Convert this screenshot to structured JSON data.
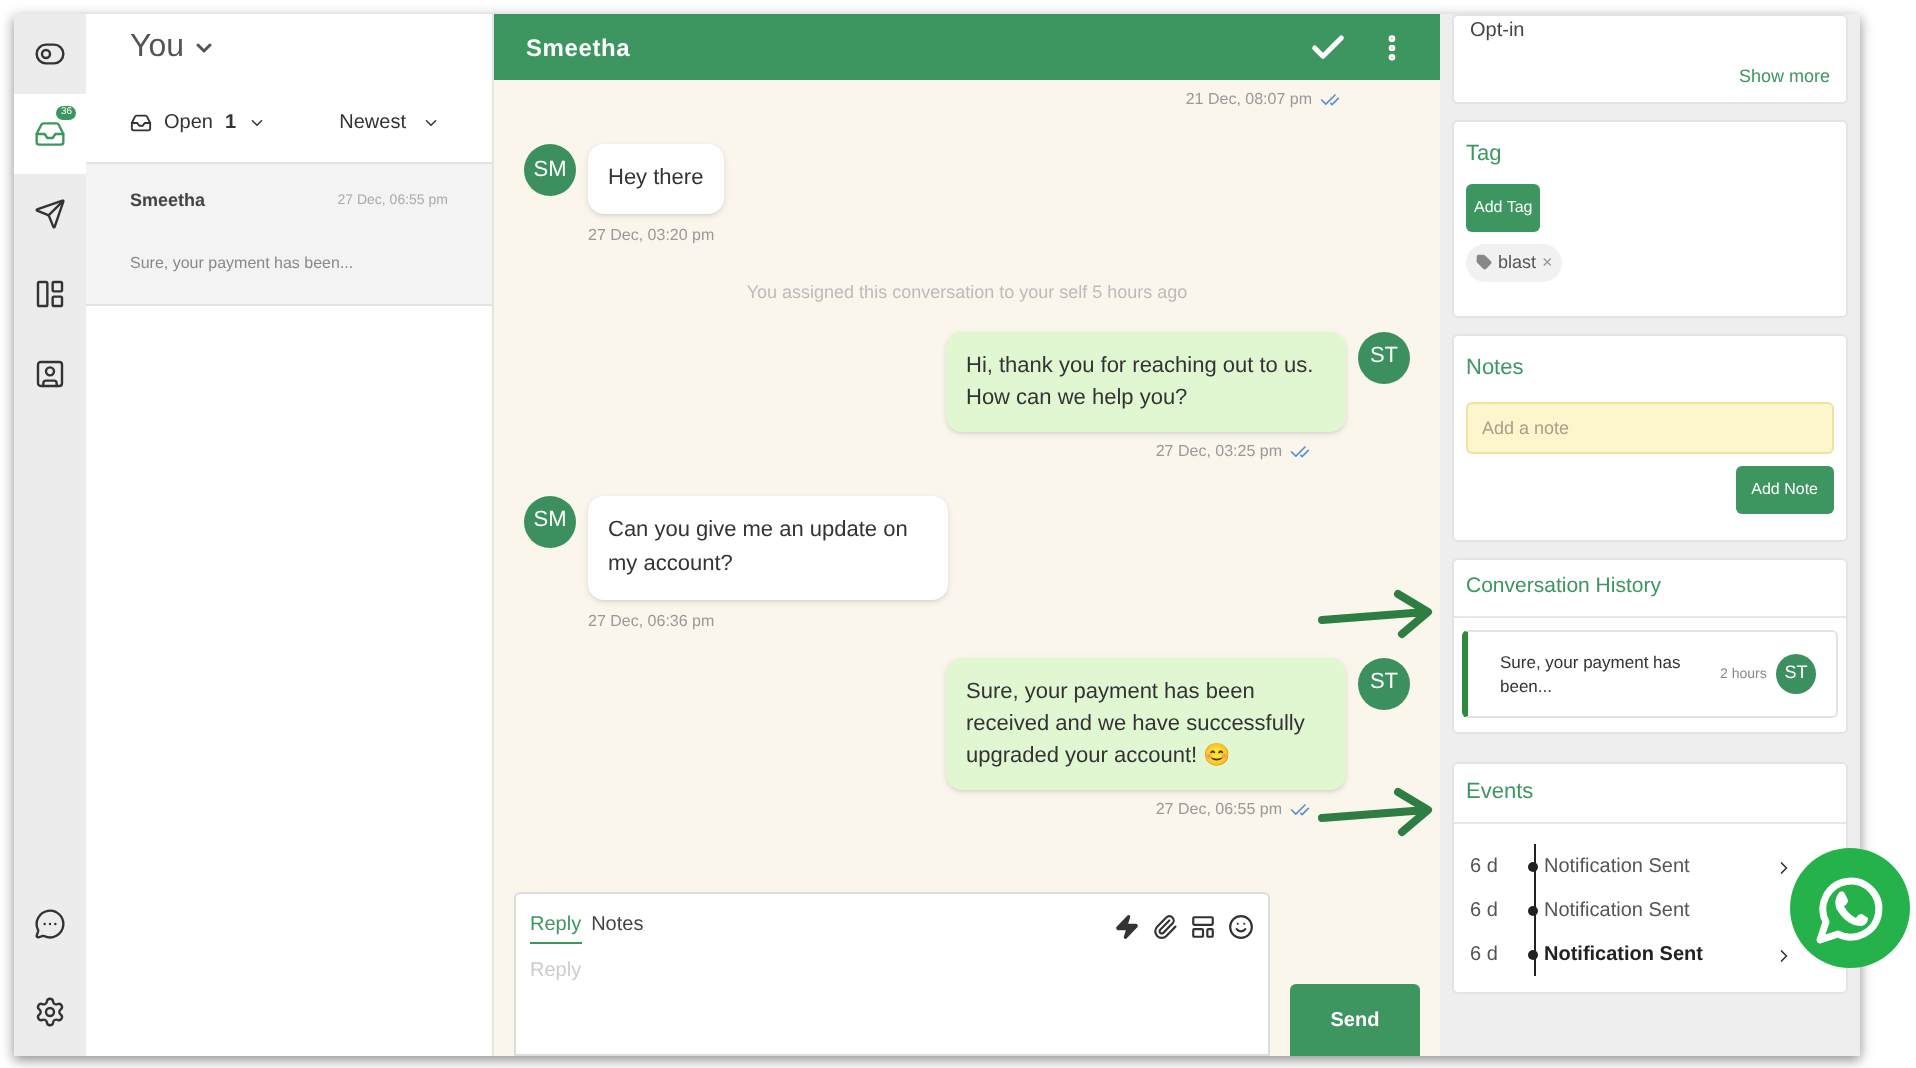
{
  "rail": {
    "items": [
      {
        "kind": "toggle",
        "selected": false
      },
      {
        "kind": "inbox",
        "selected": true,
        "badge": "36"
      },
      {
        "kind": "send",
        "selected": false
      },
      {
        "kind": "layout",
        "selected": false
      },
      {
        "kind": "contact",
        "selected": false
      }
    ],
    "bottom_items": [
      {
        "kind": "chat",
        "selected": false
      },
      {
        "kind": "settings",
        "selected": false
      }
    ]
  },
  "list": {
    "title": "You",
    "filter": "Open",
    "count": "1",
    "sort": "Newest",
    "conversations": [
      {
        "name": "Smeetha",
        "time": "27 Dec, 06:55 pm",
        "preview": "Sure, your payment has been...",
        "selected": true
      }
    ]
  },
  "chat": {
    "title": "Smeetha",
    "messages": [
      {
        "kind": "time",
        "time": "21 Dec, 08:07 pm",
        "read": true
      },
      {
        "kind": "incoming",
        "initials": "SM",
        "text": "Hey there",
        "time": "27 Dec, 03:20 pm"
      },
      {
        "kind": "system",
        "text": "You assigned this conversation to your self 5 hours ago"
      },
      {
        "kind": "outgoing",
        "initials": "ST",
        "text": "Hi, thank you for reaching out to us. How can we help you?",
        "time": "27 Dec, 03:25 pm",
        "read": true
      },
      {
        "kind": "incoming",
        "initials": "SM",
        "text": "Can you give me an update on my account?",
        "time": "27 Dec, 06:36 pm"
      },
      {
        "kind": "outgoing",
        "initials": "ST",
        "text": "Sure, your payment has been received and we have successfully upgraded your account! 😊",
        "time": "27 Dec, 06:55 pm",
        "read": true
      }
    ],
    "composer": {
      "tabs": [
        {
          "label": "Reply",
          "selected": true
        },
        {
          "label": "Notes",
          "selected": false
        }
      ],
      "placeholder": "Reply",
      "send": "Send"
    }
  },
  "details": {
    "optin": {
      "label": "Opt-in",
      "link": "Show more"
    },
    "tag": {
      "title": "Tag",
      "button": "Add Tag",
      "tags": [
        {
          "label": "blast",
          "remove": "×"
        }
      ]
    },
    "notes": {
      "title": "Notes",
      "placeholder": "Add a note",
      "button": "Add Note"
    },
    "history": {
      "title": "Conversation History",
      "items": [
        {
          "text": "Sure, your payment has been...",
          "time": "2 hours",
          "initials": "ST"
        }
      ]
    },
    "events": {
      "title": "Events",
      "items": [
        {
          "age": "6 d",
          "label": "Notification Sent",
          "bold": false,
          "chevron": true
        },
        {
          "age": "6 d",
          "label": "Notification Sent",
          "bold": false,
          "chevron": false
        },
        {
          "age": "6 d",
          "label": "Notification Sent",
          "bold": true,
          "chevron": true
        }
      ]
    }
  }
}
